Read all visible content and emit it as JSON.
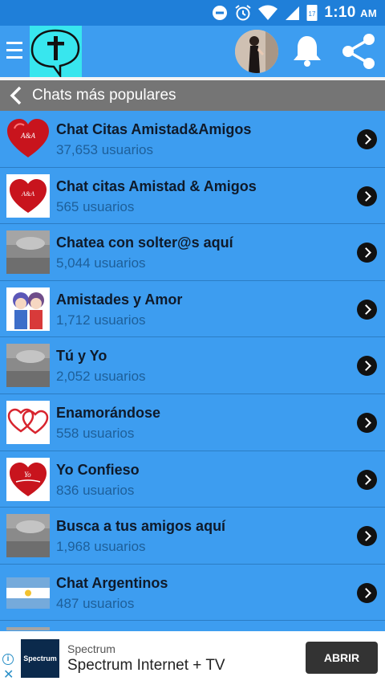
{
  "status_bar": {
    "time": "1:10",
    "ampm": "AM",
    "calendar_day": "17",
    "icons": [
      "dnd-icon",
      "alarm-icon",
      "wifi-icon",
      "signal-icon",
      "calendar-icon"
    ]
  },
  "app_bar": {
    "icons": [
      "menu-icon",
      "cross-chat-logo",
      "profile-avatar",
      "bell-icon",
      "share-icon"
    ]
  },
  "subheader": {
    "title": "Chats más populares",
    "back_icon": "chevron-left-icon"
  },
  "chats": [
    {
      "name": "Chat Citas Amistad&Amigos",
      "users": "37,653 usuarios",
      "thumb": "hearts-badge"
    },
    {
      "name": "Chat citas Amistad & Amigos",
      "users": "565 usuarios",
      "thumb": "heart-badge"
    },
    {
      "name": "Chatea con solter@s aquí",
      "users": "5,044 usuarios",
      "thumb": "gray-photo"
    },
    {
      "name": "Amistades y Amor",
      "users": "1,712 usuarios",
      "thumb": "anime-couple"
    },
    {
      "name": "Tú y Yo",
      "users": "2,052 usuarios",
      "thumb": "gray-photo"
    },
    {
      "name": "Enamorándose",
      "users": "558 usuarios",
      "thumb": "two-hearts"
    },
    {
      "name": "Yo Confieso",
      "users": "836 usuarios",
      "thumb": "confieso-heart"
    },
    {
      "name": "Busca a tus amigos aquí",
      "users": "1,968 usuarios",
      "thumb": "gray-photo"
    },
    {
      "name": "Chat Argentinos",
      "users": "487 usuarios",
      "thumb": "argentina-flag"
    }
  ],
  "ad": {
    "logo_text": "Spectrum",
    "brand": "Spectrum",
    "title": "Spectrum Internet + TV",
    "button": "ABRIR",
    "info_icon": "info-icon",
    "close_icon": "close-icon"
  },
  "colors": {
    "status_bar": "#1f7fd9",
    "primary": "#3d9df0",
    "subheader": "#757575",
    "logo_bg": "#38e6ee"
  }
}
